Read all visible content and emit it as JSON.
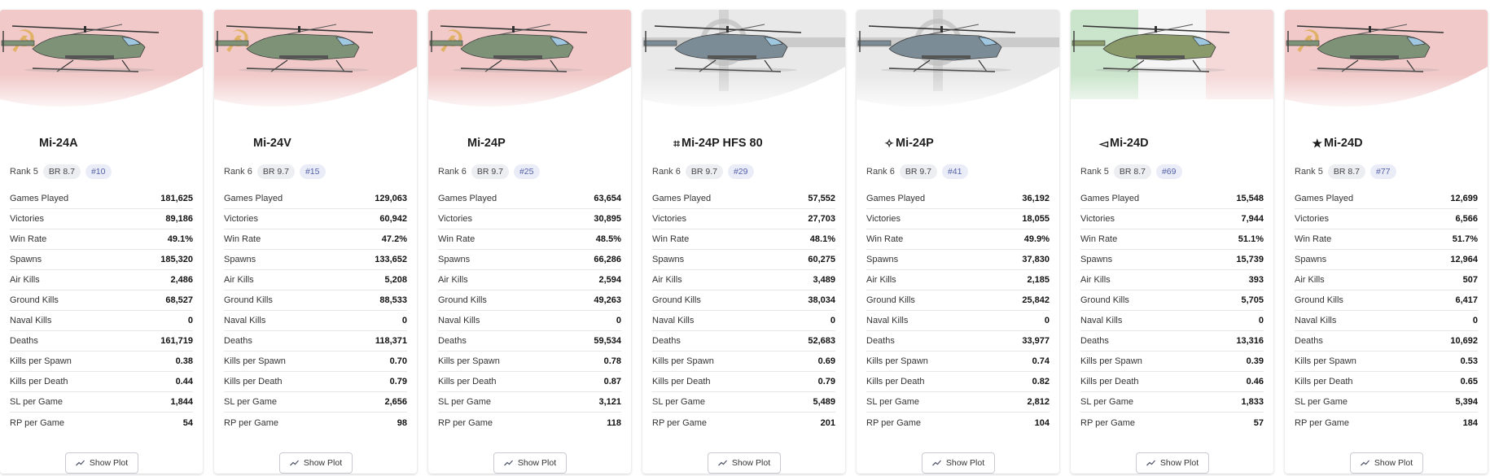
{
  "stat_labels": [
    "Games Played",
    "Victories",
    "Win Rate",
    "Spawns",
    "Air Kills",
    "Ground Kills",
    "Naval Kills",
    "Deaths",
    "Kills per Spawn",
    "Kills per Death",
    "SL per Game",
    "RP per Game"
  ],
  "show_plot_label": "Show Plot",
  "icons": {
    "plot": "line-chart-icon"
  },
  "colors": {
    "chip_bg": "#eceef2",
    "chip_pos_text": "#5560a8",
    "ussr_red": "#c62828",
    "german_grey": "#bdbdbd",
    "italy_green": "#43a047"
  },
  "cards": [
    {
      "name": "Mi-24A",
      "flag_glyph": "",
      "nation": "ussr",
      "rank": "Rank 5",
      "br": "BR 8.7",
      "pos": "#10",
      "values": [
        "181,625",
        "89,186",
        "49.1%",
        "185,320",
        "2,486",
        "68,527",
        "0",
        "161,719",
        "0.38",
        "0.44",
        "1,844",
        "54"
      ]
    },
    {
      "name": "Mi-24V",
      "flag_glyph": "",
      "nation": "ussr",
      "rank": "Rank 6",
      "br": "BR 9.7",
      "pos": "#15",
      "values": [
        "129,063",
        "60,942",
        "47.2%",
        "133,652",
        "5,208",
        "88,533",
        "0",
        "118,371",
        "0.70",
        "0.79",
        "2,656",
        "98"
      ]
    },
    {
      "name": "Mi-24P",
      "flag_glyph": "",
      "nation": "ussr",
      "rank": "Rank 6",
      "br": "BR 9.7",
      "pos": "#25",
      "values": [
        "63,654",
        "30,895",
        "48.5%",
        "66,286",
        "2,594",
        "49,263",
        "0",
        "59,534",
        "0.78",
        "0.87",
        "3,121",
        "118"
      ]
    },
    {
      "name": "Mi-24P HFS 80",
      "flag_glyph": "⌗",
      "nation": "germany",
      "rank": "Rank 6",
      "br": "BR 9.7",
      "pos": "#29",
      "values": [
        "57,552",
        "27,703",
        "48.1%",
        "60,275",
        "3,489",
        "38,034",
        "0",
        "52,683",
        "0.69",
        "0.79",
        "5,489",
        "201"
      ]
    },
    {
      "name": "Mi-24P",
      "flag_glyph": "✧",
      "nation": "germany",
      "rank": "Rank 6",
      "br": "BR 9.7",
      "pos": "#41",
      "values": [
        "36,192",
        "18,055",
        "49.9%",
        "37,830",
        "2,185",
        "25,842",
        "0",
        "33,977",
        "0.74",
        "0.82",
        "2,812",
        "104"
      ]
    },
    {
      "name": "Mi-24D",
      "flag_glyph": "◅",
      "nation": "italy",
      "rank": "Rank 5",
      "br": "BR 8.7",
      "pos": "#69",
      "values": [
        "15,548",
        "7,944",
        "51.1%",
        "15,739",
        "393",
        "5,705",
        "0",
        "13,316",
        "0.39",
        "0.46",
        "1,833",
        "57"
      ]
    },
    {
      "name": "Mi-24D",
      "flag_glyph": "★",
      "nation": "ussr",
      "rank": "Rank 5",
      "br": "BR 8.7",
      "pos": "#77",
      "values": [
        "12,699",
        "6,566",
        "51.7%",
        "12,964",
        "507",
        "6,417",
        "0",
        "10,692",
        "0.53",
        "0.65",
        "5,394",
        "184"
      ]
    }
  ]
}
